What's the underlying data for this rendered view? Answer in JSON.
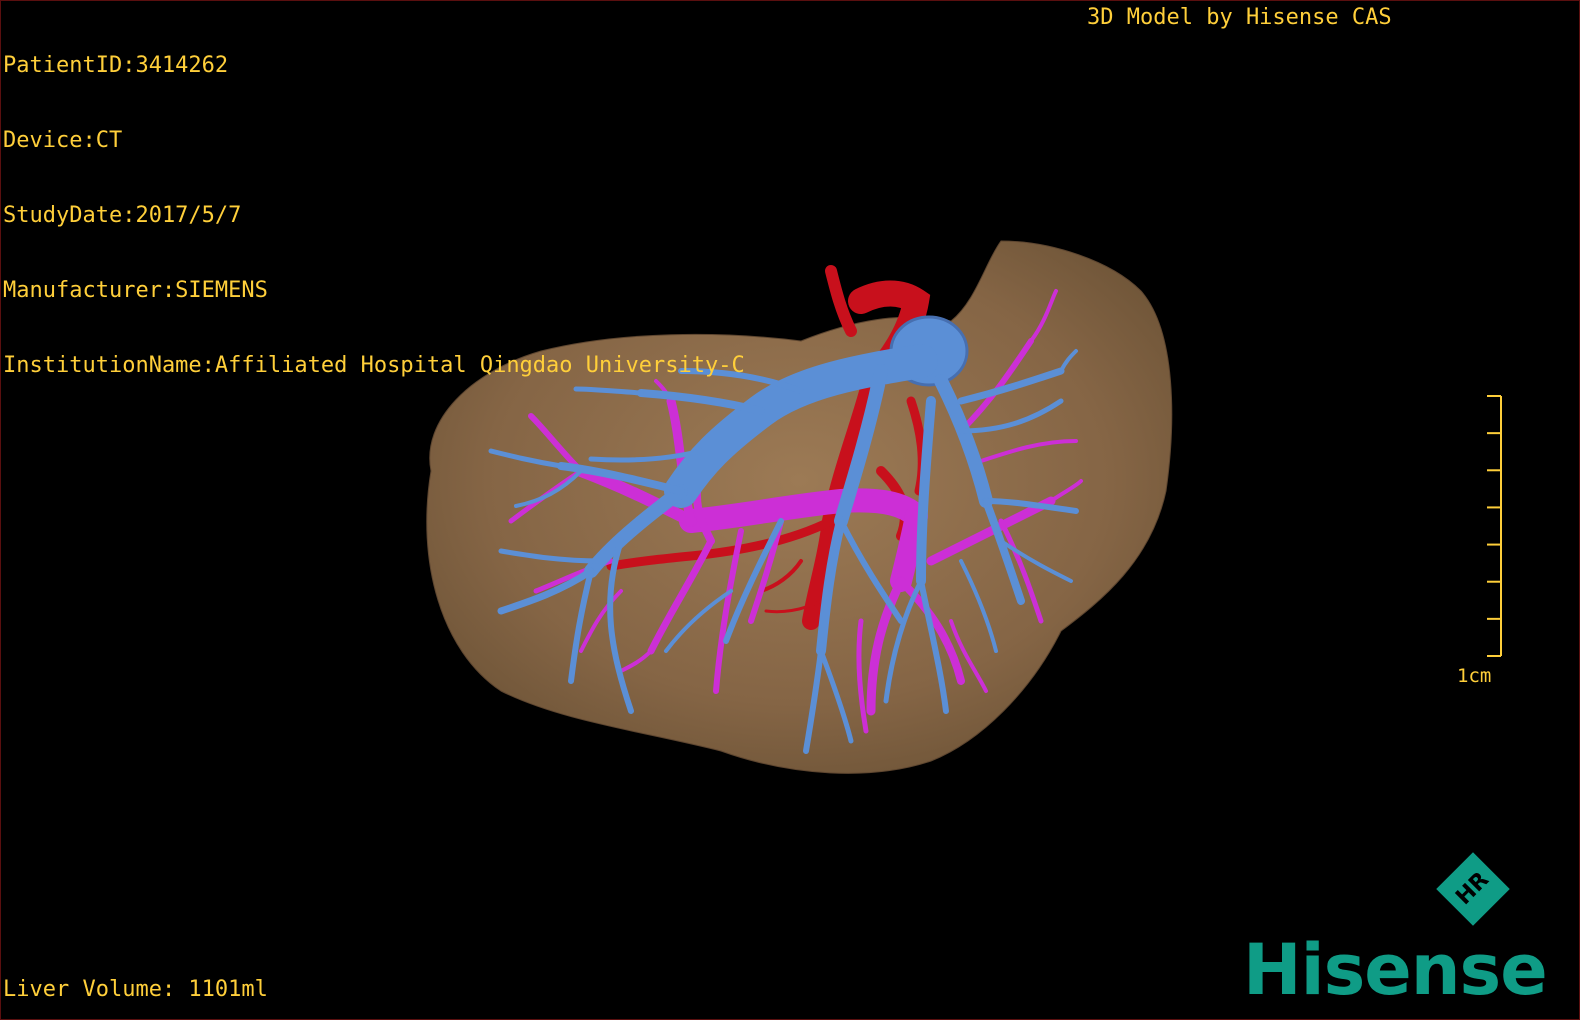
{
  "study_info": {
    "patient_id": "PatientID:3414262",
    "device": "Device:CT",
    "study_date": "StudyDate:2017/5/7",
    "manufacturer": "Manufacturer:SIEMENS",
    "institution": "InstitutionName:Affiliated Hospital Qingdao University-C"
  },
  "model_credit": "3D Model by Hisense CAS",
  "liver_volume": "Liver Volume: 1101ml",
  "scale": {
    "label": "1cm",
    "ticks": 7,
    "color": "#ffcf3a"
  },
  "model": {
    "liver_color": "#8a6a47",
    "hepatic_vein_color": "#5b8fd6",
    "portal_vein_color": "#cc2fd6",
    "artery_color": "#c8101c"
  },
  "branding": {
    "brand_name": "Hisense",
    "logo_letters": "HR",
    "brand_color": "#0f9c86"
  }
}
